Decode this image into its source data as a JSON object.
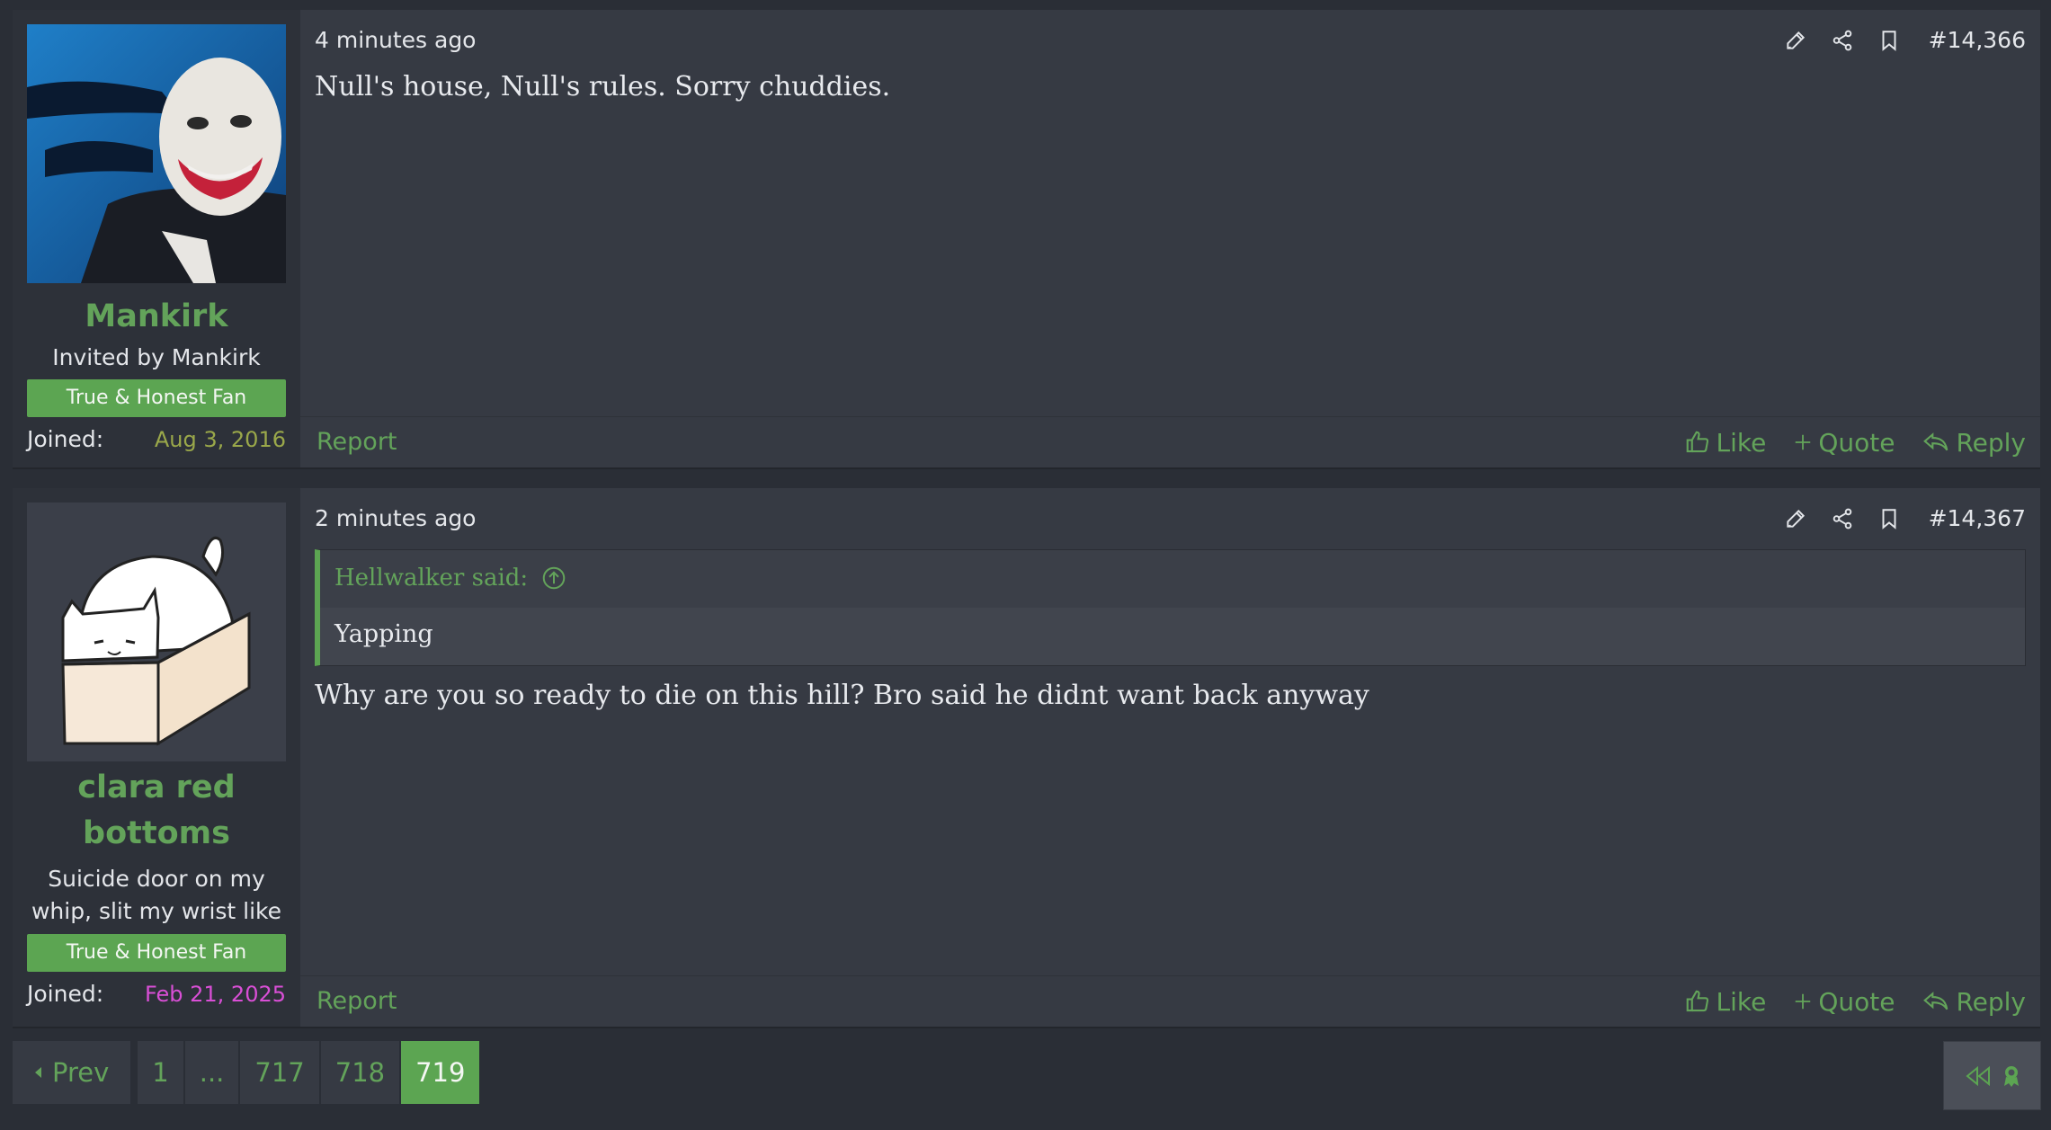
{
  "posts": [
    {
      "author": "Mankirk",
      "user_title": "Invited by Mankirk",
      "banner": "True & Honest Fan",
      "joined_label": "Joined:",
      "joined_date": "Aug 3, 2016",
      "joined_color": "#9aa84a",
      "time": "4 minutes ago",
      "post_number": "#14,366",
      "body": "Null's house, Null's rules. Sorry chuddies.",
      "report_label": "Report",
      "like_label": "Like",
      "quote_label": "Quote",
      "reply_label": "Reply"
    },
    {
      "author": "clara red bottoms",
      "user_title": "Suicide door on my whip, slit my wrist like",
      "banner": "True & Honest Fan",
      "joined_label": "Joined:",
      "joined_date": "Feb 21, 2025",
      "joined_color": "#d94fd6",
      "time": "2 minutes ago",
      "post_number": "#14,367",
      "quote_author": "Hellwalker said:",
      "quote_text": "Yapping",
      "body": "Why are you so ready to die on this hill? Bro said he didnt want back anyway",
      "report_label": "Report",
      "like_label": "Like",
      "quote_label": "Quote",
      "reply_label": "Reply"
    }
  ],
  "pagination": {
    "prev_label": "Prev",
    "pages": [
      "1",
      "...",
      "717",
      "718",
      "719"
    ],
    "current": "719"
  },
  "colors": {
    "accent": "#5ca552",
    "link": "#63a35a",
    "background": "#2a2e36",
    "post_bg": "#363a43"
  },
  "icons": [
    "edit-icon",
    "share-icon",
    "bookmark-icon",
    "thumbs-up-icon",
    "plus-icon",
    "reply-icon",
    "jump-to-source-icon",
    "rewind-icon",
    "ribbon-icon",
    "caret-left-icon"
  ]
}
